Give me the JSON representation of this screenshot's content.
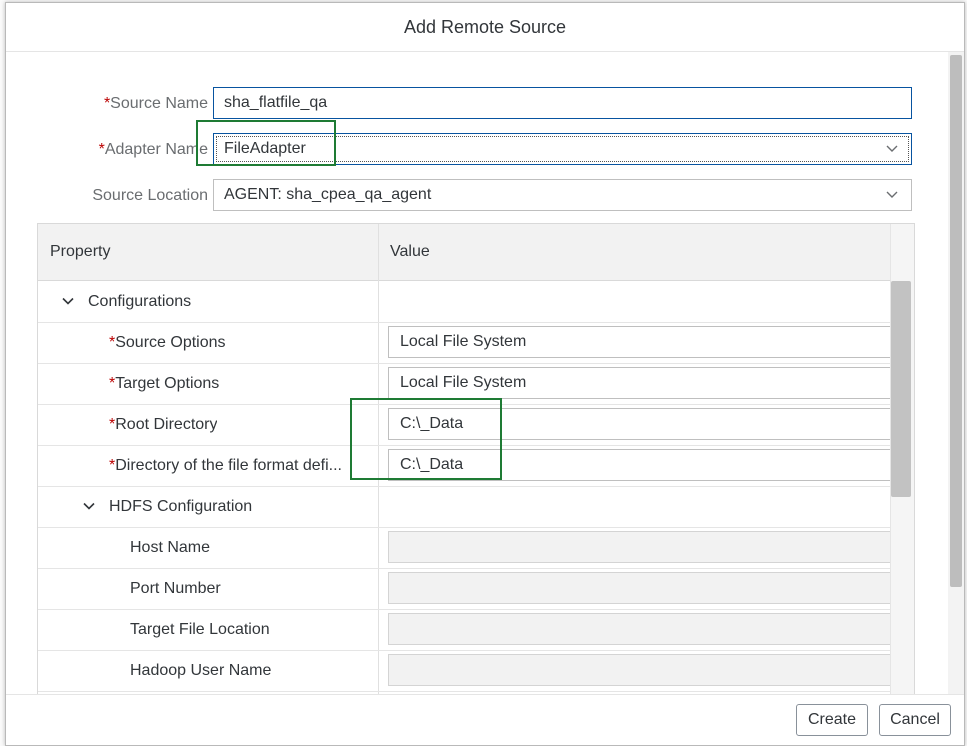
{
  "dialog": {
    "title": "Add Remote Source"
  },
  "form": {
    "source_name": {
      "label": "Source Name",
      "value": "sha_flatfile_qa",
      "required": true
    },
    "adapter_name": {
      "label": "Adapter Name",
      "value": "FileAdapter",
      "required": true
    },
    "source_location": {
      "label": "Source Location",
      "value": "AGENT: sha_cpea_qa_agent",
      "required": false
    }
  },
  "table": {
    "headers": {
      "property": "Property",
      "value": "Value"
    },
    "rows": [
      {
        "label": "Configurations",
        "type": "group",
        "value": ""
      },
      {
        "label": "Source Options",
        "type": "select",
        "required": true,
        "value": "Local File System"
      },
      {
        "label": "Target Options",
        "type": "select",
        "required": true,
        "value": "Local File System"
      },
      {
        "label": "Root Directory",
        "type": "input",
        "required": true,
        "value": "C:\\_Data"
      },
      {
        "label": "Directory of the file format defi...",
        "type": "input",
        "required": true,
        "value": "C:\\_Data"
      },
      {
        "label": "HDFS Configuration",
        "type": "group",
        "value": ""
      },
      {
        "label": "Host Name",
        "type": "disabled",
        "value": ""
      },
      {
        "label": "Port Number",
        "type": "disabled",
        "value": ""
      },
      {
        "label": "Target File Location",
        "type": "disabled",
        "value": ""
      },
      {
        "label": "Hadoop User Name",
        "type": "disabled",
        "value": ""
      }
    ]
  },
  "required_marker": "*",
  "footer": {
    "create_label": "Create",
    "cancel_label": "Cancel"
  },
  "colors": {
    "highlight": "#1e7b34",
    "required": "#bb0000",
    "focus": "#0854a0"
  }
}
